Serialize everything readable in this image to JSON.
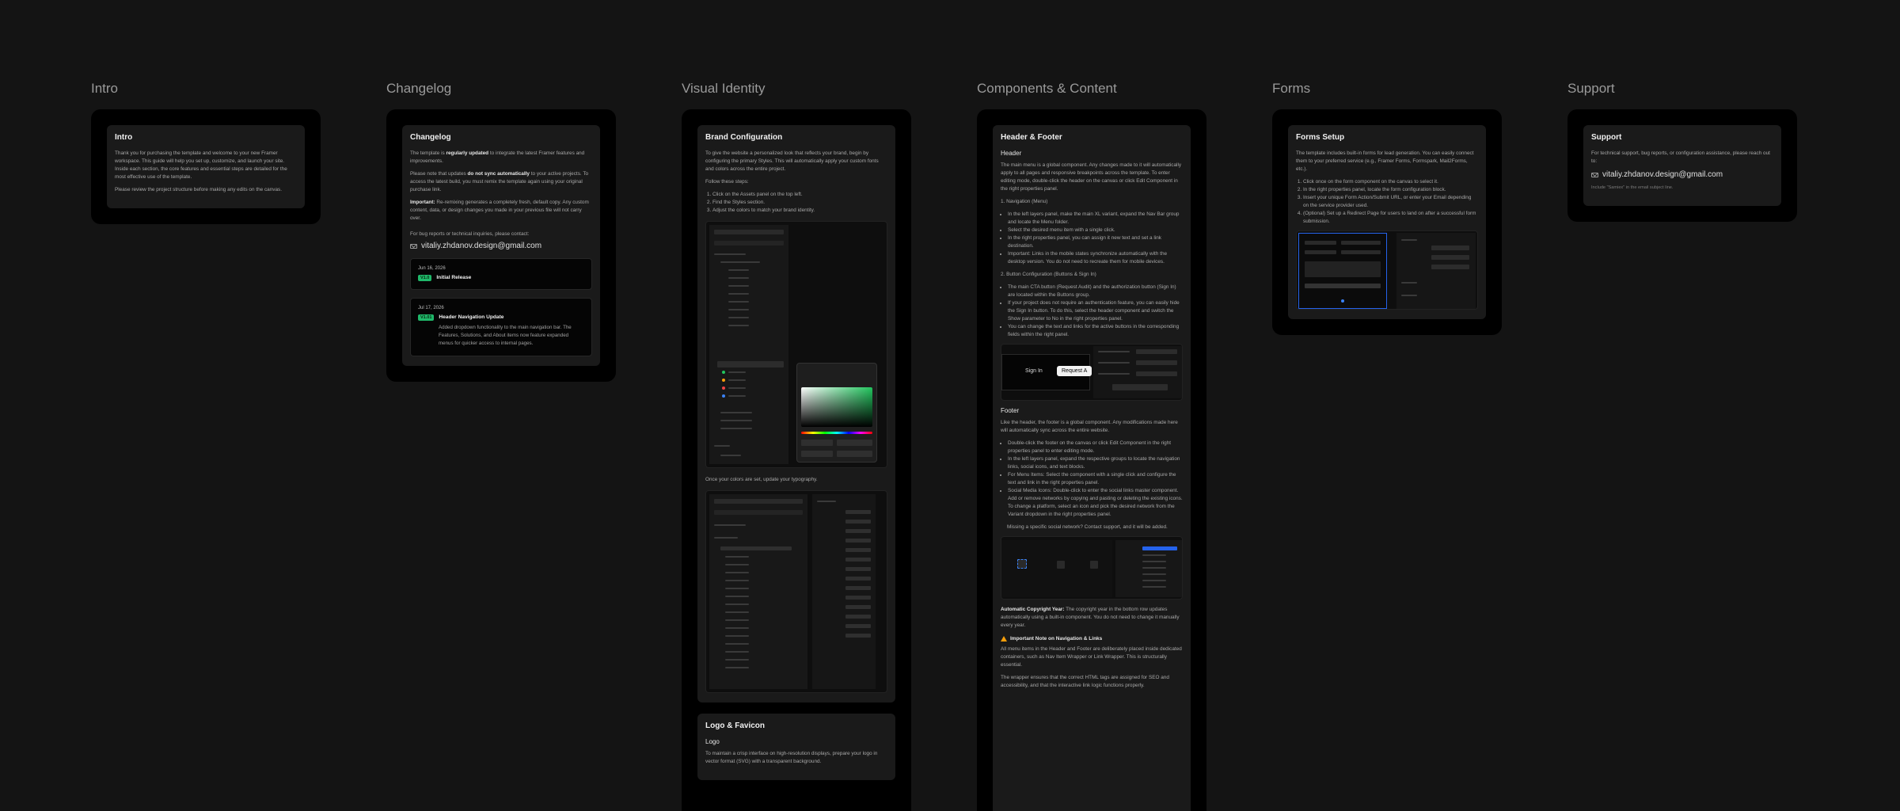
{
  "columns": {
    "intro": {
      "title": "Intro",
      "card_title": "Intro",
      "p1": "Thank you for purchasing the template and welcome to your new Framer workspace. This guide will help you set up, customize, and launch your site. Inside each section, the core features and essential steps are detailed for the most effective use of the template.",
      "p2": "Please review the project structure before making any edits on the canvas."
    },
    "changelog": {
      "title": "Changelog",
      "card_title": "Changelog",
      "p1_a": "The template is ",
      "p1_b": "regularly updated",
      "p1_c": " to integrate the latest Framer features and improvements.",
      "p2_a": "Please note that updates ",
      "p2_b": "do not sync automatically",
      "p2_c": " to your active projects. To access the latest build, you must remix the template again using your original purchase link.",
      "p3_a": "Important:",
      "p3_b": " Re-remixing generates a completely fresh, default copy. Any custom content, data, or design changes you made in your previous file will not carry over.",
      "p4": "For bug reports or technical inquiries, please contact:",
      "email": "vitaliy.zhdanov.design@gmail.com",
      "entries": [
        {
          "date": "Jun 16, 2026",
          "version": "V1.0",
          "title": "Initial Release",
          "desc": ""
        },
        {
          "date": "Jul 17, 2026",
          "version": "V1.01",
          "title": "Header Navigation Update",
          "desc": "Added dropdown functionality to the main navigation bar. The Features, Solutions, and About items now feature expanded menus for quicker access to internal pages."
        }
      ]
    },
    "visual": {
      "title": "Visual Identity",
      "card_title": "Brand Configuration",
      "p1": "To give the website a personalized look that reflects your brand, begin by configuring the primary Styles. This will automatically apply your custom fonts and colors across the entire project.",
      "p2": "Follow these steps:",
      "steps": [
        "Click on the Assets panel on the top left.",
        "Find the Styles section.",
        "Adjust the colors to match your brand identity."
      ],
      "p3": "Once your colors are set, update your typography.",
      "card2_title": "Logo & Favicon",
      "logo_h": "Logo",
      "logo_p": "To maintain a crisp interface on high-resolution displays, prepare your logo in vector format (SVG) with a transparent background."
    },
    "components": {
      "title": "Components & Content",
      "card_title": "Header & Footer",
      "header_h": "Header",
      "header_p": "The main menu is a global component. Any changes made to it will automatically apply to all pages and responsive breakpoints across the template. To enter editing mode, double-click the header on the canvas or click Edit Component in the right properties panel.",
      "nav_h": "1. Navigation (Menu)",
      "nav_items": [
        "In the left layers panel, make the main XL variant, expand the Nav Bar group and locate the Menu folder.",
        "Select the desired menu item with a single click.",
        "In the right properties panel, you can assign it new text and set a link destination.",
        "Important: Links in the mobile states synchronize automatically with the desktop version. You do not need to recreate them for mobile devices."
      ],
      "btn_h": "2. Button Configuration (Buttons & Sign In)",
      "btn_items": [
        "The main CTA button (Request Audit) and the authorization button (Sign In) are located within the Buttons group.",
        "If your project does not require an authentication feature, you can easily hide the Sign In button. To do this, select the header component and switch the Show parameter to No in the right properties panel.",
        "You can change the text and links for the active buttons in the corresponding fields within the right panel."
      ],
      "mock_signin": "Sign In",
      "mock_request": "Request A",
      "footer_h": "Footer",
      "footer_p": "Like the header, the footer is a global component. Any modifications made here will automatically sync across the entire website.",
      "footer_items": [
        "Double-click the footer on the canvas or click Edit Component in the right properties panel to enter editing mode.",
        "In the left layers panel, expand the respective groups to locate the navigation links, social icons, and text blocks.",
        "For Menu Items: Select the component with a single click and configure the text and link in the right properties panel.",
        "Social Media Icons: Double-click to enter the social links master component. Add or remove networks by copying and pasting or deleting the existing icons. To change a platform, select an icon and pick the desired network from the Variant dropdown in the right properties panel."
      ],
      "missing": "Missing a specific social network? Contact support, and it will be added.",
      "copyright_a": "Automatic Copyright Year:",
      "copyright_b": " The copyright year in the bottom row updates automatically using a built-in component. You do not need to change it manually every year.",
      "note_h": "Important Note on Navigation & Links",
      "note_p1": "All menu items in the Header and Footer are deliberately placed inside dedicated containers, such as Nav Item Wrapper or Link Wrapper. This is structurally essential.",
      "note_p2": "The wrapper ensures that the correct HTML tags are assigned for SEO and accessibility, and that the interactive link logic functions properly."
    },
    "forms": {
      "title": "Forms",
      "card_title": "Forms Setup",
      "p1": "The template includes built-in forms for lead generation. You can easily connect them to your preferred service (e.g., Framer Forms, Formspark, Mail2Forms, etc.).",
      "steps": [
        "Click once on the form component on the canvas to select it.",
        "In the right properties panel, locate the form configuration block.",
        "Insert your unique Form Action/Submit URL, or enter your Email depending on the service provider used.",
        "(Optional) Set up a Redirect Page for users to land on after a successful form submission."
      ]
    },
    "support": {
      "title": "Support",
      "card_title": "Support",
      "p1": "For technical support, bug reports, or configuration assistance, please reach out to:",
      "email": "vitaliy.zhdanov.design@gmail.com",
      "note": "Include \"Samiex\" in the email subject line."
    }
  }
}
